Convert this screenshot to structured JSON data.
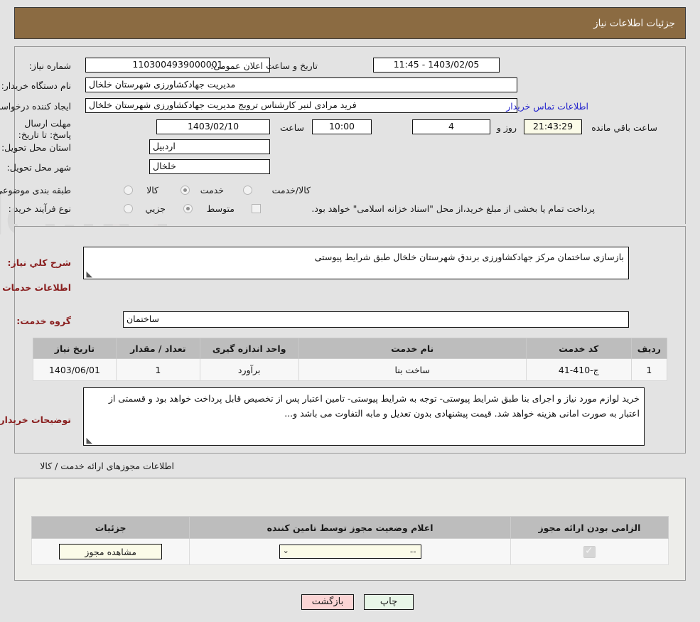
{
  "header": {
    "title": "جزئیات اطلاعات نیاز"
  },
  "info": {
    "need_number_label": "شماره نیاز:",
    "need_number_value": "1103004939000001",
    "announce_label": "تاریخ و ساعت اعلان عمومی:",
    "announce_value": "1403/02/05 - 11:45",
    "buyer_org_label": "نام دستگاه خریدار:",
    "buyer_org_value": "مدیریت جهادکشاورزی شهرستان خلخال",
    "creator_label": "ایجاد کننده درخواست:",
    "creator_value": "فرید مرادی لنبر کارشناس ترویج مدیریت جهادکشاورزی شهرستان خلخال",
    "contact_link": "اطلاعات تماس خریدار",
    "deadline_label": "مهلت ارسال پاسخ: تا تاریخ:",
    "deadline_date": "1403/02/10",
    "hour_label": "ساعت",
    "deadline_time": "10:00",
    "days_value": "4",
    "days_label": "روز و",
    "countdown": "21:43:29",
    "countdown_label": "ساعت باقي مانده",
    "province_label": "استان محل تحویل:",
    "province_value": "اردبیل",
    "city_label": "شهر محل تحویل:",
    "city_value": "خلخال",
    "category_label": "طبقه بندی موضوعی:",
    "category_options": [
      {
        "label": "کالا",
        "selected": false
      },
      {
        "label": "خدمت",
        "selected": true
      },
      {
        "label": "کالا/خدمت",
        "selected": false
      }
    ],
    "process_label": "نوع فرآیند خرید :",
    "process_options": [
      {
        "label": "جزیي",
        "selected": false
      },
      {
        "label": "متوسط",
        "selected": true
      }
    ],
    "treasury_note": "پرداخت تمام یا بخشی از مبلغ خرید،از محل \"اسناد خزانه اسلامی\" خواهد بود."
  },
  "description": {
    "general_label": "شرح كلي نياز:",
    "general_value": "بازسازی ساختمان مرکز جهادکشاورزی برندق شهرستان خلخال طبق شرایط پیوستی",
    "services_heading": "اطلاعات خدمات مورد نیاز",
    "service_group_label": "گروه خدمت:",
    "service_group_value": "ساختمان",
    "buyer_notes_label": "توضیحات خریدار:",
    "buyer_notes_value": "خرید لوازم مورد نیاز و اجرای بنا طبق شرایط پیوستی- توجه به شرایط پیوستی- تامین اعتبار پس از تخصیص قابل پرداخت خواهد بود و قسمتی از اعتبار به صورت امانی هزینه خواهد شد. قیمت پیشنهادی بدون تعدیل و مابه التفاوت می باشد و..."
  },
  "services_table": {
    "columns": [
      "ردیف",
      "کد خدمت",
      "نام خدمت",
      "واحد اندازه گیری",
      "تعداد / مقدار",
      "تاریخ نیاز"
    ],
    "rows": [
      {
        "row": "1",
        "code": "ج-410-41",
        "name": "ساخت بنا",
        "unit": "برآورد",
        "qty": "1",
        "date": "1403/06/01"
      }
    ]
  },
  "permits": {
    "section_title": "اطلاعات مجوزهای ارائه خدمت / کالا",
    "columns": [
      "الزامی بودن ارائه مجوز",
      "اعلام وضعیت مجوز توسط تامین کننده",
      "جزئیات"
    ],
    "rows": [
      {
        "required": true,
        "status_value": "--",
        "details_button": "مشاهده مجوز"
      }
    ]
  },
  "footer": {
    "print_label": "چاپ",
    "return_label": "بازگشت"
  },
  "colors": {
    "header_brown": "#8b6b42",
    "page_background": "#e3e3e3",
    "link_blue": "#2222cc",
    "heading_red": "#8a2020",
    "table_header_gray": "#bdbdbd",
    "cream_field": "#fbfbe8",
    "print_green": "#e8f6e8",
    "return_pink": "#fbd5d5"
  }
}
